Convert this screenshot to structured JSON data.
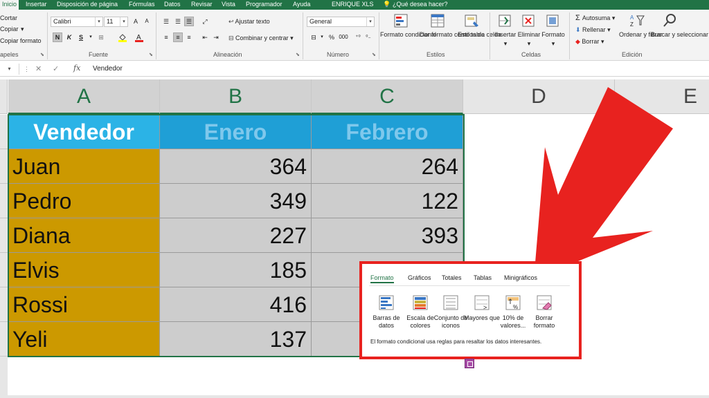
{
  "ribbon_tabs": [
    {
      "label": "Inicio",
      "active": true
    },
    {
      "label": "Insertar"
    },
    {
      "label": "Disposición de página"
    },
    {
      "label": "Fórmulas"
    },
    {
      "label": "Datos"
    },
    {
      "label": "Revisar"
    },
    {
      "label": "Vista"
    },
    {
      "label": "Programador"
    },
    {
      "label": "Ayuda"
    },
    {
      "label": "ENRIQUE XLS"
    },
    {
      "label": "¿Qué desea hacer?"
    }
  ],
  "clipboard": {
    "cut": "Cortar",
    "copy": "Copiar",
    "copy_format": "Copiar formato",
    "group": "apeles"
  },
  "font": {
    "name": "Calibri",
    "size": "11",
    "bold": "N",
    "italic": "K",
    "underline": "S",
    "grow": "A",
    "shrink": "A",
    "group": "Fuente"
  },
  "alignment": {
    "wrap_text": "Ajustar texto",
    "merge_center": "Combinar y centrar",
    "group": "Alineación"
  },
  "number": {
    "format": "General",
    "percent": "%",
    "thousands": "000",
    "group": "Número"
  },
  "styles": {
    "conditional": "Formato condicional",
    "as_table": "Dar formato como tabla",
    "cell_styles": "Estilos de celda",
    "group": "Estilos"
  },
  "cells": {
    "insert": "Insertar",
    "delete": "Eliminar",
    "format": "Formato",
    "group": "Celdas"
  },
  "editing": {
    "autosum": "Autosuma",
    "fill": "Rellenar",
    "clear": "Borrar",
    "sort_filter": "Ordenar y filtrar",
    "find_select": "Buscar y seleccionar",
    "group": "Edición"
  },
  "formula_bar": {
    "fx": "fx",
    "content": "Vendedor"
  },
  "columns": [
    "A",
    "B",
    "C",
    "D",
    "E"
  ],
  "table": {
    "headers": [
      "Vendedor",
      "Enero",
      "Febrero"
    ],
    "rows": [
      {
        "name": "Juan",
        "enero": "364",
        "febrero": "264"
      },
      {
        "name": "Pedro",
        "enero": "349",
        "febrero": "122"
      },
      {
        "name": "Diana",
        "enero": "227",
        "febrero": "393"
      },
      {
        "name": "Elvis",
        "enero": "185",
        "febrero": ""
      },
      {
        "name": "Rossi",
        "enero": "416",
        "febrero": ""
      },
      {
        "name": "Yeli",
        "enero": "137",
        "febrero": ""
      }
    ]
  },
  "quick_analysis": {
    "tabs": [
      "Formato",
      "Gráficos",
      "Totales",
      "Tablas",
      "Minigráficos"
    ],
    "options": [
      {
        "label": "Barras de datos",
        "icon": "data-bars-icon"
      },
      {
        "label": "Escala de colores",
        "icon": "color-scale-icon"
      },
      {
        "label": "Conjunto de iconos",
        "icon": "icon-set-icon"
      },
      {
        "label": "Mayores que",
        "icon": "greater-than-icon"
      },
      {
        "label": "10% de valores...",
        "icon": "top-ten-icon"
      },
      {
        "label": "Borrar formato",
        "icon": "clear-format-icon"
      }
    ],
    "description": "El formato condicional usa reglas para resaltar los datos interesantes."
  },
  "colors": {
    "excel_green": "#217346",
    "header_blue": "#2bb3e6",
    "name_fill": "#cc9900",
    "number_fill": "#cdcdcd",
    "arrow_red": "#e8221f"
  }
}
